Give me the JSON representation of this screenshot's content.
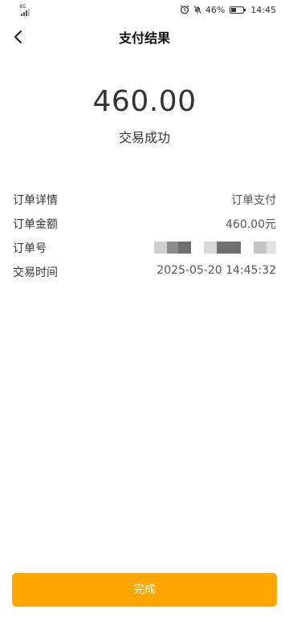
{
  "status_bar": {
    "network": "4G",
    "battery": "46%",
    "battery_level": 0.46,
    "time": "14:45",
    "icons": [
      "alarm-icon",
      "mute-icon",
      "battery-icon"
    ]
  },
  "header": {
    "back_icon": "chevron-left-icon",
    "title": "支付结果"
  },
  "result": {
    "amount": "460.00",
    "status": "交易成功"
  },
  "details": {
    "rows": [
      {
        "label": "订单详情",
        "value": "订单支付"
      },
      {
        "label": "订单金额",
        "value": "460.00元"
      },
      {
        "label": "订单号",
        "value": ""
      },
      {
        "label": "交易时间",
        "value": "2025-05-20 14:45:32"
      }
    ]
  },
  "footer": {
    "done_label": "完成"
  },
  "colors": {
    "accent": "#ffa600",
    "text": "#333333"
  }
}
